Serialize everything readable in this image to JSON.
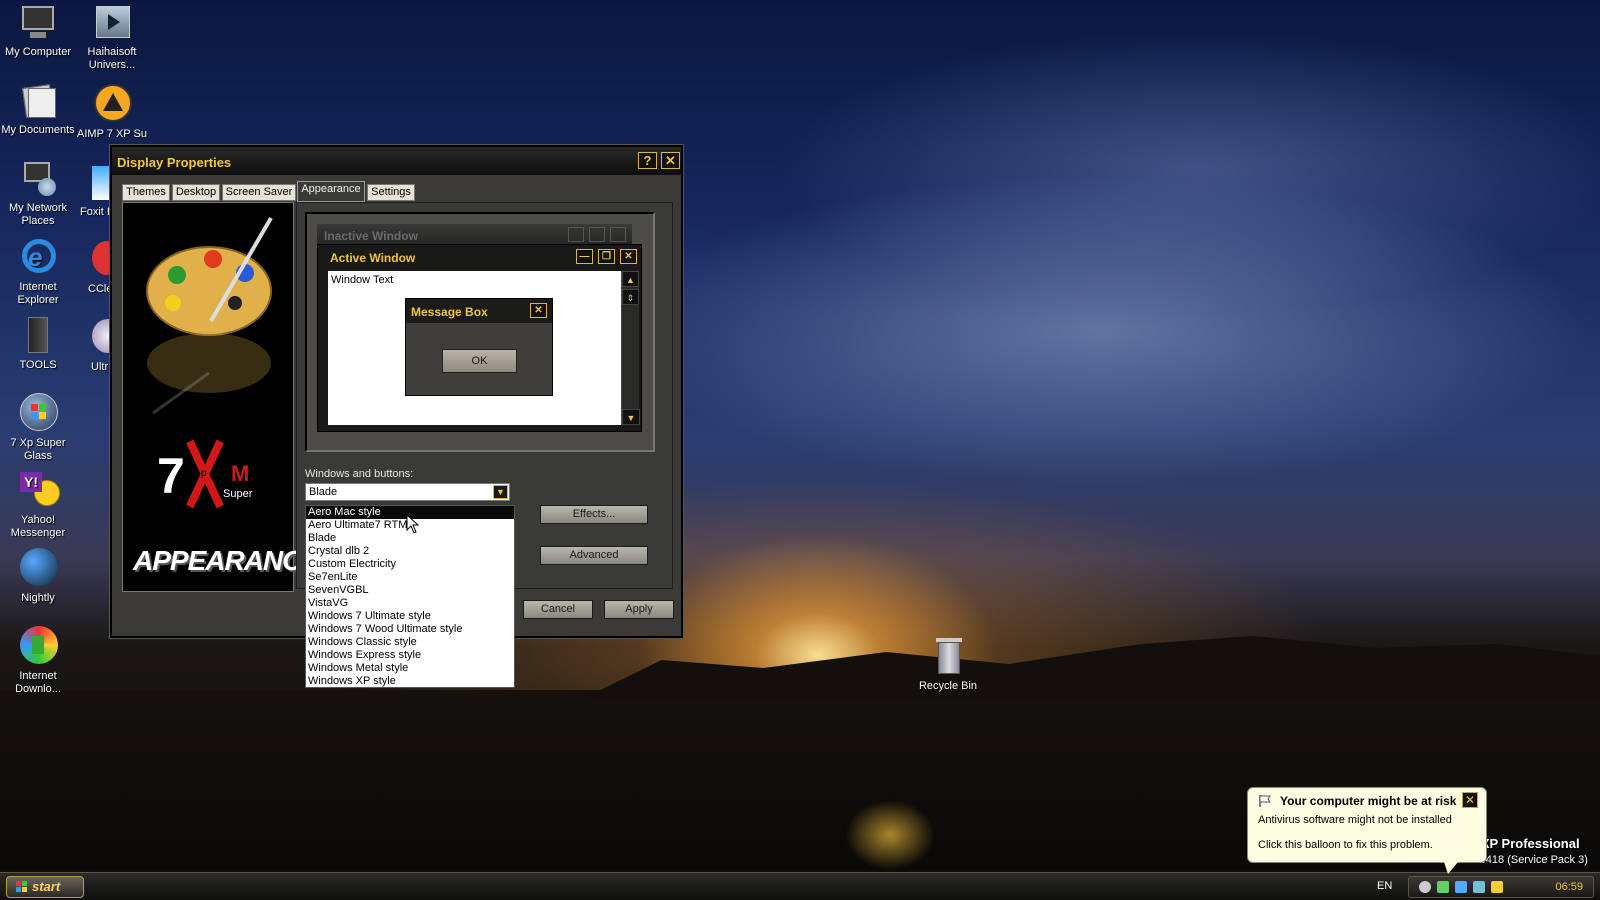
{
  "desktop": {
    "icons": [
      {
        "label": "My Computer",
        "icon": "my-computer-icon"
      },
      {
        "label": "Haihaisoft Univers...",
        "icon": "media-player-icon"
      },
      {
        "label": "My Documents",
        "icon": "my-documents-icon"
      },
      {
        "label": "AIMP 7 XP Su",
        "icon": "aimp-icon"
      },
      {
        "label": "My Network Places",
        "icon": "network-icon"
      },
      {
        "label": "Foxit I",
        "icon": "foxit-icon"
      },
      {
        "label": "Internet Explorer",
        "icon": "internet-explorer-icon"
      },
      {
        "label": "CCle",
        "icon": "ccleaner-icon"
      },
      {
        "label": "TOOLS",
        "icon": "tools-icon"
      },
      {
        "label": "Ultr",
        "icon": "ultraiso-icon"
      },
      {
        "label": "7 Xp Super Glass",
        "icon": "windows-orb-icon"
      },
      {
        "label": "Yahoo! Messenger",
        "icon": "yahoo-messenger-icon"
      },
      {
        "label": "Nightly",
        "icon": "nightly-globe-icon"
      },
      {
        "label": "Internet Downlo...",
        "icon": "internet-download-icon"
      },
      {
        "label": "Recycle Bin",
        "icon": "recycle-bin-icon"
      }
    ]
  },
  "dialog": {
    "title": "Display Properties",
    "help_glyph": "?",
    "close_glyph": "✕",
    "tabs": [
      "Themes",
      "Desktop",
      "Screen Saver",
      "Appearance",
      "Settings"
    ],
    "side_image": {
      "logo_number": "7",
      "logo_small_p": "p",
      "logo_letter": "M",
      "logo_super": "Super",
      "caption": "APPEARANCE"
    },
    "preview": {
      "inactive_title": "Inactive Window",
      "active_title": "Active Window",
      "window_text": "Window Text",
      "message_box_title": "Message Box",
      "ok_label": "OK"
    },
    "windows_buttons_label": "Windows and buttons:",
    "windows_buttons_value": "Blade",
    "effects_label": "Effects...",
    "advanced_label": "Advanced",
    "cancel_label": "Cancel",
    "apply_label": "Apply",
    "dropdown_options": [
      "Aero Mac style",
      "Aero Ultimate7 RTM",
      "Blade",
      "Crystal dlb 2",
      "Custom Electricity",
      "Se7enLite",
      "SevenVGBL",
      "VistaVG",
      "Windows 7 Ultimate style",
      "Windows 7 Wood Ultimate style",
      "Windows Classic style",
      "Windows Express style",
      "Windows Metal style",
      "Windows XP style"
    ],
    "dropdown_highlighted": "Aero Mac style"
  },
  "balloon": {
    "title": "Your computer might be at risk",
    "line1": "Antivirus software might not be installed",
    "line2": "Click this balloon to fix this problem."
  },
  "os_watermark": {
    "name": "s XP Professional",
    "build": "-0418 (Service Pack 3)"
  },
  "taskbar": {
    "start_label": "start",
    "language": "EN",
    "clock": "06:59"
  },
  "colors": {
    "accent_gold": "#f0c640",
    "window_dark": "#3b3a37"
  }
}
